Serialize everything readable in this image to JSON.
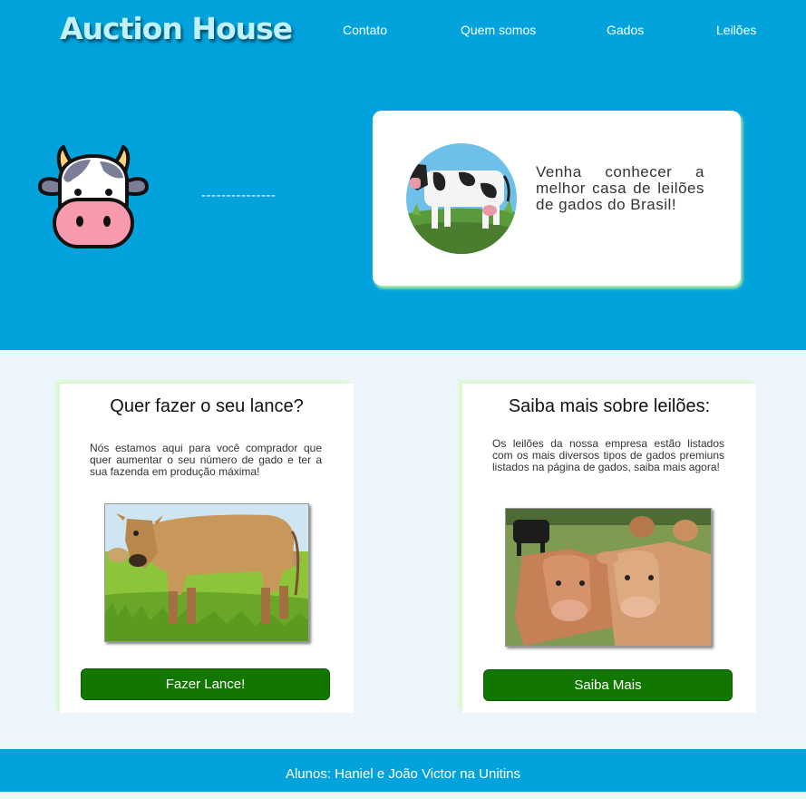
{
  "header": {
    "site_title": "Auction House",
    "nav": [
      {
        "label": "Contato"
      },
      {
        "label": "Quem somos"
      },
      {
        "label": "Gados"
      },
      {
        "label": "Leilões"
      }
    ]
  },
  "hero": {
    "divider_text": "---------------",
    "intro_text": "Venha conhecer a melhor casa de leilões de gados do Brasil!"
  },
  "cards": [
    {
      "title": "Quer fazer o seu lance?",
      "description": "Nós estamos aqui para você comprador que quer aumentar o seu número de gado e ter a sua fazenda em produção máxima!",
      "button_label": "Fazer Lance!"
    },
    {
      "title": "Saiba mais sobre leilões:",
      "description": "Os leilões da nossa empresa estão listados com os mais diversos tipos de gados premiuns listados na página de gados, saiba mais agora!",
      "button_label": "Saiba Mais"
    }
  ],
  "footer": {
    "text": "Alunos: Haniel e João Victor na Unitins"
  },
  "colors": {
    "hero_bg": "#02a3dd",
    "page_bg": "#eef6fd",
    "button_green": "#117700",
    "card_glow": "#b6f39a"
  }
}
